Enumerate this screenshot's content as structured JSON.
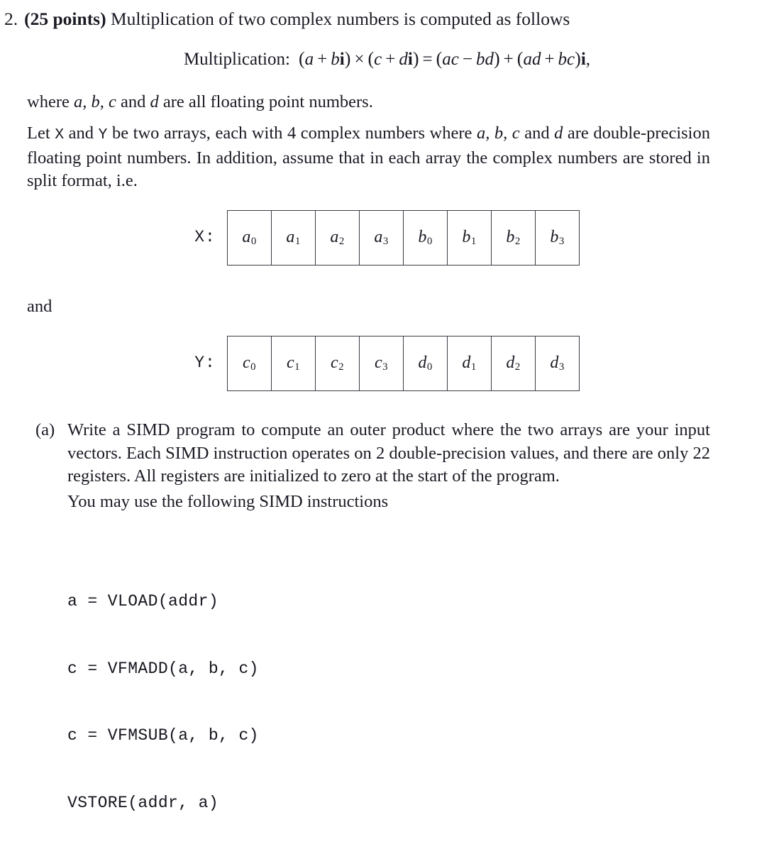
{
  "document": {
    "problem_number": "2.",
    "points_label": "(25 points)",
    "heading_text": "Multiplication of two complex numbers is computed as follows",
    "equation": {
      "label": "Multiplication:",
      "lhs_1_open": "(",
      "lhs_1_a": "a",
      "lhs_1_plus": "+",
      "lhs_1_b": "b",
      "lhs_1_i": "i",
      "lhs_1_close": ")",
      "times": "×",
      "lhs_2_open": "(",
      "lhs_2_c": "c",
      "lhs_2_plus": "+",
      "lhs_2_d": "d",
      "lhs_2_i": "i",
      "lhs_2_close": ")",
      "equals": "=",
      "rhs_1_open": "(",
      "rhs_1_ac": "ac",
      "rhs_1_minus": "−",
      "rhs_1_bd": "bd",
      "rhs_1_close": ")",
      "rhs_plus": "+",
      "rhs_2_open": "(",
      "rhs_2_ad": "ad",
      "rhs_2_plus": "+",
      "rhs_2_bc": "bc",
      "rhs_2_close": ")",
      "rhs_2_i": "i",
      "trailing_comma": ","
    },
    "paragraph_where": {
      "pre": "where ",
      "vars": "a, b, c",
      "mid": " and ",
      "var_d": "d",
      "post": " are all floating point numbers."
    },
    "paragraph_let": {
      "s1": "Let ",
      "var_x": "X",
      "s2": " and ",
      "var_y": "Y",
      "s3": " be two arrays, each with 4 complex numbers where ",
      "vars_abc": "a, b, c",
      "s4": " and ",
      "var_d": "d",
      "s5": " are double-precision floating point numbers. In addition, assume that in each array the complex numbers are stored in split format, i.e."
    },
    "and_text": "and",
    "arrays": [
      {
        "name": "x-array",
        "label": "X:",
        "cells": [
          {
            "base": "a",
            "sub": "0"
          },
          {
            "base": "a",
            "sub": "1"
          },
          {
            "base": "a",
            "sub": "2"
          },
          {
            "base": "a",
            "sub": "3"
          },
          {
            "base": "b",
            "sub": "0"
          },
          {
            "base": "b",
            "sub": "1"
          },
          {
            "base": "b",
            "sub": "2"
          },
          {
            "base": "b",
            "sub": "3"
          }
        ]
      },
      {
        "name": "y-array",
        "label": "Y:",
        "cells": [
          {
            "base": "c",
            "sub": "0"
          },
          {
            "base": "c",
            "sub": "1"
          },
          {
            "base": "c",
            "sub": "2"
          },
          {
            "base": "c",
            "sub": "3"
          },
          {
            "base": "d",
            "sub": "0"
          },
          {
            "base": "d",
            "sub": "1"
          },
          {
            "base": "d",
            "sub": "2"
          },
          {
            "base": "d",
            "sub": "3"
          }
        ]
      }
    ],
    "part_a": {
      "marker": "(a)",
      "text": "Write a SIMD program to compute an outer product where the two arrays are your input vectors. Each SIMD instruction operates on 2 double-precision values, and there are only 22 registers. All registers are initialized to zero at the start of the program.",
      "followup": "You may use the following SIMD instructions"
    },
    "code_lines": [
      "a = VLOAD(addr)",
      "c = VFMADD(a, b, c)",
      "c = VFMSUB(a, b, c)",
      "VSTORE(addr, a)"
    ]
  }
}
